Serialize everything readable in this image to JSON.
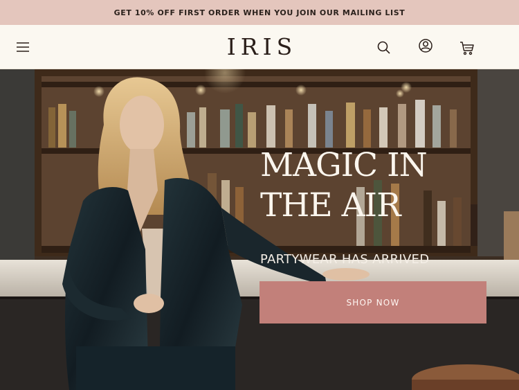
{
  "promo": {
    "text": "GET 10% OFF FIRST ORDER WHEN YOU JOIN OUR MAILING LIST"
  },
  "header": {
    "logo": "IRIS",
    "icons": {
      "menu": "menu-icon",
      "search": "search-icon",
      "account": "user-icon",
      "cart": "cart-icon"
    }
  },
  "hero": {
    "headline_line1": "MAGIC IN",
    "headline_line2": "THE AIR",
    "subhead": "PARTYWEAR HAS ARRIVED",
    "cta_label": "SHOP NOW"
  },
  "colors": {
    "promo_bg": "#e4c6bd",
    "header_bg": "#fbf8f1",
    "cta_bg": "#c2807a",
    "text_dark": "#2a1e19"
  }
}
